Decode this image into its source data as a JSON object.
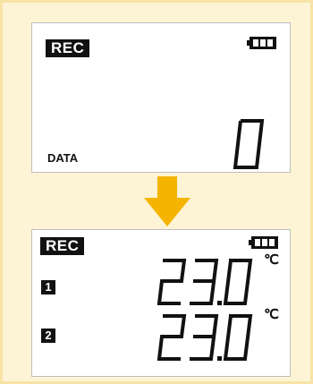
{
  "top_panel": {
    "rec_label": "REC",
    "battery_icon": "battery-full-icon",
    "data_label": "DATA",
    "data_count": "0"
  },
  "arrow_icon": "down-arrow-icon",
  "arrow_color": "#f5b400",
  "bottom_panel": {
    "rec_label": "REC",
    "battery_icon": "battery-full-icon",
    "channels": [
      {
        "label": "1",
        "value": "23.0",
        "unit": "℃"
      },
      {
        "label": "2",
        "value": "23.0",
        "unit": "℃"
      }
    ]
  }
}
